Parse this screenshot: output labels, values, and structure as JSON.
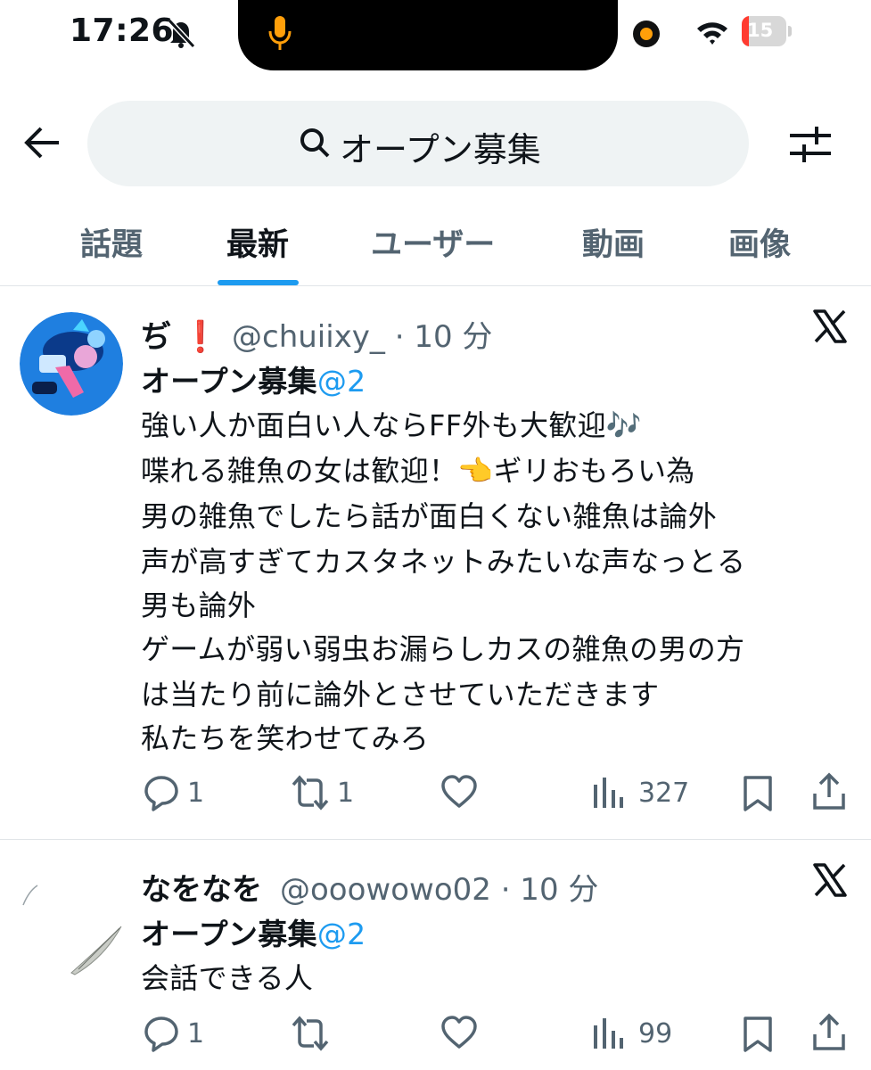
{
  "status_bar": {
    "time": "17:26",
    "battery": "15",
    "battery_level_percent": 15,
    "icons": [
      "bell-slash-icon",
      "mic-icon",
      "recording-dot-icon",
      "wifi-icon",
      "battery-charging-icon"
    ]
  },
  "header": {
    "search_query": "オープン募集",
    "icons": [
      "back-arrow-icon",
      "search-icon",
      "filter-sliders-icon"
    ]
  },
  "tabs": [
    {
      "label": "話題",
      "active": false
    },
    {
      "label": "最新",
      "active": true
    },
    {
      "label": "ユーザー",
      "active": false
    },
    {
      "label": "動画",
      "active": false
    },
    {
      "label": "画像",
      "active": false
    }
  ],
  "colors": {
    "accent": "#1d9bf0",
    "secondary_text": "#536471",
    "search_bg": "#eff3f4",
    "orange": "#ff9f0a",
    "battery_red": "#ff3b30"
  },
  "tweets": [
    {
      "name": "ぢ",
      "name_emoji": "❗",
      "handle_time": "@chuiixy_ · 10 分",
      "title": "オープン募集",
      "mention": "@2",
      "lines": [
        "強い人か面白い人ならFF外も大歓迎🎶",
        "喋れる雑魚の女は歓迎！👈ギリおもろい為",
        "男の雑魚でしたら話が面白くない雑魚は論外",
        "声が高すぎてカスタネットみたいな声なっとる",
        "男も論外",
        "ゲームが弱い弱虫お漏らしカスの雑魚の男の方",
        "は当たり前に論外とさせていただきます",
        "私たちを笑わせてみろ"
      ],
      "replies": "1",
      "retweets": "1",
      "likes": "",
      "views": "327"
    },
    {
      "name": "なをなを",
      "handle_time": "@ooowowo02 · 10 分",
      "title": "オープン募集",
      "mention": "@2",
      "lines": [
        "会話できる人"
      ],
      "replies": "1",
      "retweets": "",
      "likes": "",
      "views": "99"
    }
  ]
}
